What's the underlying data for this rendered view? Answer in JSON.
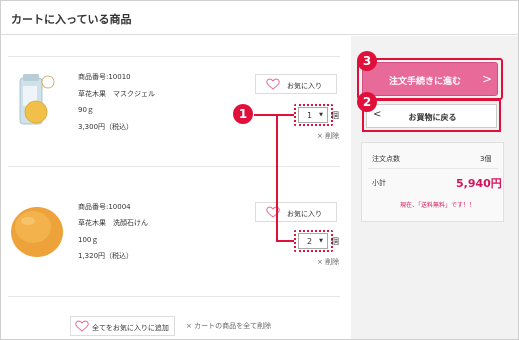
{
  "header": {
    "title": "カートに入っている商品"
  },
  "items": [
    {
      "code": "商品番号:10010",
      "name": "草花木果　マスクジェル",
      "size": "90ｇ",
      "price": "3,300円（税込）",
      "fav_label": "お気に入り",
      "qty": "1",
      "unit": "個",
      "delete_label": "× 削除"
    },
    {
      "code": "商品番号:10004",
      "name": "草花木果　洗顔石けん",
      "size": "100ｇ",
      "price": "1,320円（税込）",
      "fav_label": "お気に入り",
      "qty": "2",
      "unit": "個",
      "delete_label": "× 削除"
    }
  ],
  "footer": {
    "fav_all_label": "全てをお気に入りに追加",
    "delete_all_label": "× カートの商品を全て削除"
  },
  "sidebar": {
    "order_button": "注文手続きに進む",
    "back_button": "お買物に戻る",
    "count_label": "注文点数",
    "count_value": "3個",
    "subtotal_label": "小計",
    "subtotal_value": "5,940円",
    "promo": "現在、「送料無料」です！！"
  },
  "annotations": {
    "badge1": "1",
    "badge2": "2",
    "badge3": "3"
  },
  "colors": {
    "accent_pink": "#e86a99",
    "annotation_red": "#e0103a",
    "price_red": "#d4145a"
  },
  "icons": [
    "heart-icon",
    "chevron-right-icon",
    "chevron-left-icon",
    "caret-down-icon"
  ]
}
